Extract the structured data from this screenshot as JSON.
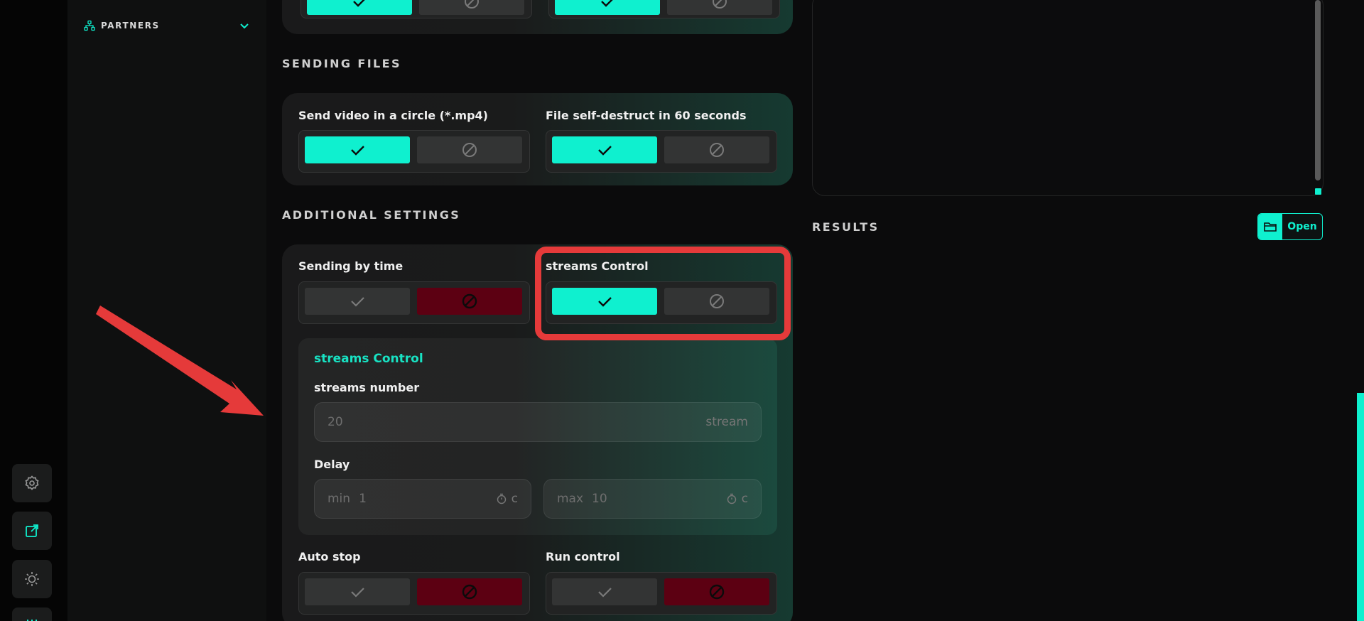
{
  "sidebar": {
    "partners_label": "PARTNERS"
  },
  "sending_files": {
    "title": "SENDING FILES",
    "options": [
      {
        "label": "Send video in a circle (*.mp4)",
        "enabled": true
      },
      {
        "label": "File self-destruct in 60 seconds",
        "enabled": true
      }
    ]
  },
  "additional": {
    "title": "ADDITIONAL SETTINGS",
    "sending_by_time": {
      "label": "Sending by time",
      "enabled": false
    },
    "streams_control": {
      "label": "streams Control",
      "enabled": true
    },
    "panel": {
      "title": "streams Control",
      "streams_number_label": "streams number",
      "streams_number_value": "20",
      "streams_number_unit": "stream",
      "delay_label": "Delay",
      "delay_min_prefix": "min",
      "delay_min_value": "1",
      "delay_max_prefix": "max",
      "delay_max_value": "10",
      "delay_unit": "c"
    },
    "auto_stop": {
      "label": "Auto stop",
      "enabled": false
    },
    "run_control": {
      "label": "Run control",
      "enabled": false
    }
  },
  "results": {
    "title": "RESULTS",
    "open_label": "Open"
  },
  "colors": {
    "accent": "#0ff0cf",
    "danger": "#5c0012",
    "highlight": "#e53a3a"
  },
  "icons": [
    "partners-icon",
    "chevron-down-icon",
    "check-icon",
    "block-icon",
    "settings-icon",
    "external-link-icon",
    "theme-icon",
    "folder-icon",
    "timer-icon"
  ]
}
